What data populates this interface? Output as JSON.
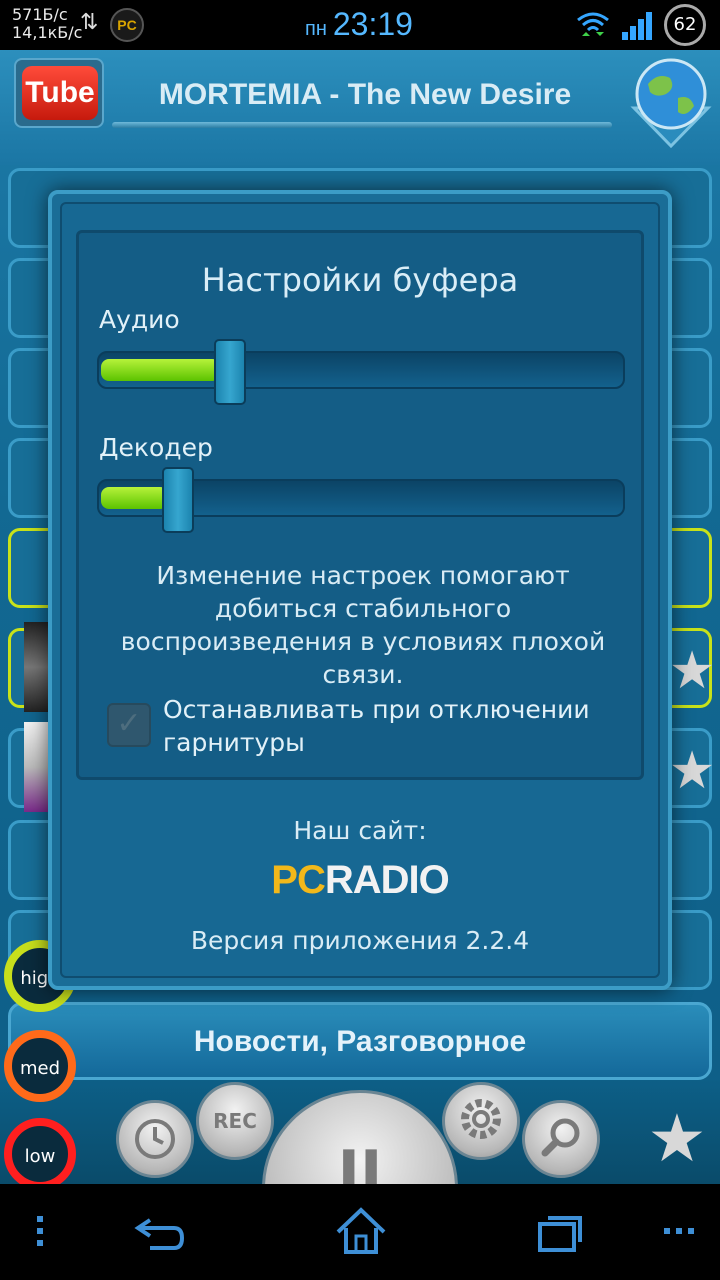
{
  "status_bar": {
    "net_down": "571Б/с",
    "net_up": "14,1кБ/с",
    "net_arrows": "⇅",
    "app_icon": "PC",
    "day": "пн",
    "time": "23:19",
    "battery": "62"
  },
  "app": {
    "youtube_label": "Tube",
    "station_title": "MORTEMIA - The New Desire",
    "genre": "Новости, Разговорное",
    "quality": {
      "high": "high",
      "med": "med",
      "low": "low"
    },
    "controls": {
      "rec": "REC",
      "pause": "II"
    }
  },
  "dialog": {
    "title": "Настройки буфера",
    "audio_label": "Аудио",
    "audio_level": 0.22,
    "decoder_label": "Декодер",
    "decoder_level": 0.12,
    "info_text": "Изменение настроек помогают добиться стабильного воспроизведения в условиях плохой связи.",
    "checkbox_label": "Останавливать при отключении гарнитуры",
    "checkbox_checked": false,
    "site_label": "Наш сайт:",
    "logo_pc": "PC",
    "logo_radio": "RADIO",
    "version": "Версия приложения 2.2.4"
  },
  "colors": {
    "accent_green": "#5cc300",
    "active_border": "#c8e21a",
    "high": "#c7df1c",
    "med": "#ff6a1a",
    "low": "#ff1f1f",
    "nav_icon": "#3e8fd6"
  },
  "icons": {
    "signal": "signal-icon",
    "wifi": "wifi-icon",
    "globe": "globe-icon",
    "star": "star-icon",
    "clock": "clock-icon",
    "gear": "gear-icon",
    "search": "search-icon",
    "back": "back-icon",
    "home": "home-icon",
    "recents": "recents-icon",
    "menu": "menu-icon"
  }
}
